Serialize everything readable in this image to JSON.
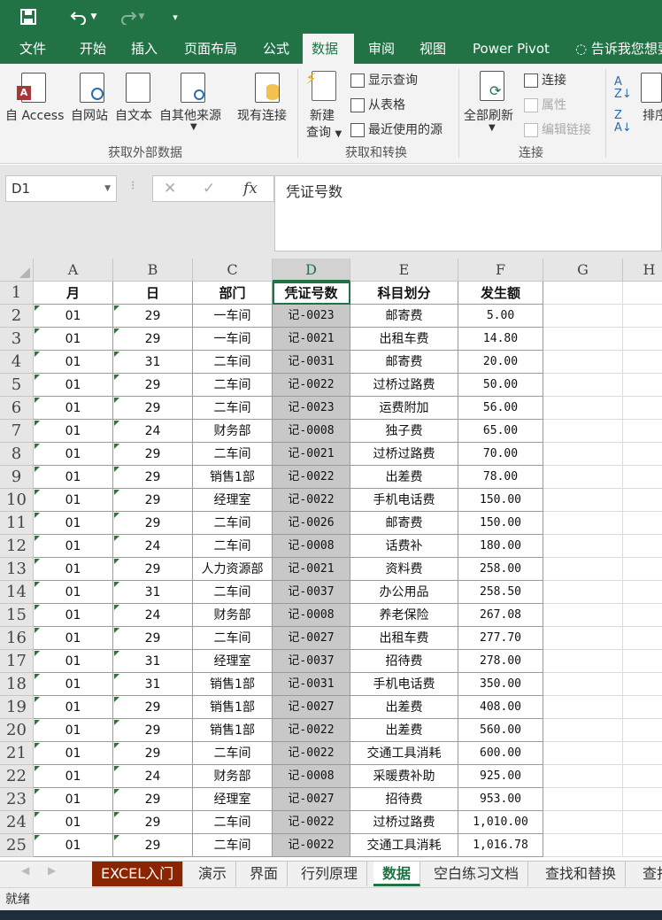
{
  "ribbon_tabs": [
    "文件",
    "开始",
    "插入",
    "页面布局",
    "公式",
    "数据",
    "审阅",
    "视图",
    "Power Pivot",
    "告诉我您想要"
  ],
  "active_tab": "数据",
  "ribbon": {
    "access": "自 Access",
    "web": "自网站",
    "text": "自文本",
    "other": "自其他来源",
    "existing": "现有连接",
    "group1": "获取外部数据",
    "new_query_1": "新建",
    "new_query_2": "查询",
    "show_query": "显示查询",
    "from_table": "从表格",
    "recent_sources": "最近使用的源",
    "group2": "获取和转换",
    "refresh_all": "全部刷新",
    "connections": "连接",
    "properties": "属性",
    "edit_links": "编辑链接",
    "group3": "连接",
    "sort": "排序"
  },
  "formula_bar": {
    "name_box": "D1",
    "fx": "fx",
    "content": "凭证号数"
  },
  "columns": [
    "A",
    "B",
    "C",
    "D",
    "E",
    "F",
    "G",
    "H"
  ],
  "selected_column": "D",
  "header_row": [
    "月",
    "日",
    "部门",
    "凭证号数",
    "科目划分",
    "发生额"
  ],
  "rows": [
    [
      "01",
      "29",
      "一车间",
      "记-0023",
      "邮寄费",
      "5.00"
    ],
    [
      "01",
      "29",
      "一车间",
      "记-0021",
      "出租车费",
      "14.80"
    ],
    [
      "01",
      "31",
      "二车间",
      "记-0031",
      "邮寄费",
      "20.00"
    ],
    [
      "01",
      "29",
      "二车间",
      "记-0022",
      "过桥过路费",
      "50.00"
    ],
    [
      "01",
      "29",
      "二车间",
      "记-0023",
      "运费附加",
      "56.00"
    ],
    [
      "01",
      "24",
      "财务部",
      "记-0008",
      "独子费",
      "65.00"
    ],
    [
      "01",
      "29",
      "二车间",
      "记-0021",
      "过桥过路费",
      "70.00"
    ],
    [
      "01",
      "29",
      "销售1部",
      "记-0022",
      "出差费",
      "78.00"
    ],
    [
      "01",
      "29",
      "经理室",
      "记-0022",
      "手机电话费",
      "150.00"
    ],
    [
      "01",
      "29",
      "二车间",
      "记-0026",
      "邮寄费",
      "150.00"
    ],
    [
      "01",
      "24",
      "二车间",
      "记-0008",
      "话费补",
      "180.00"
    ],
    [
      "01",
      "29",
      "人力资源部",
      "记-0021",
      "资料费",
      "258.00"
    ],
    [
      "01",
      "31",
      "二车间",
      "记-0037",
      "办公用品",
      "258.50"
    ],
    [
      "01",
      "24",
      "财务部",
      "记-0008",
      "养老保险",
      "267.08"
    ],
    [
      "01",
      "29",
      "二车间",
      "记-0027",
      "出租车费",
      "277.70"
    ],
    [
      "01",
      "31",
      "经理室",
      "记-0037",
      "招待费",
      "278.00"
    ],
    [
      "01",
      "31",
      "销售1部",
      "记-0031",
      "手机电话费",
      "350.00"
    ],
    [
      "01",
      "29",
      "销售1部",
      "记-0027",
      "出差费",
      "408.00"
    ],
    [
      "01",
      "29",
      "销售1部",
      "记-0022",
      "出差费",
      "560.00"
    ],
    [
      "01",
      "29",
      "二车间",
      "记-0022",
      "交通工具消耗",
      "600.00"
    ],
    [
      "01",
      "24",
      "财务部",
      "记-0008",
      "采暖费补助",
      "925.00"
    ],
    [
      "01",
      "29",
      "经理室",
      "记-0027",
      "招待费",
      "953.00"
    ],
    [
      "01",
      "29",
      "二车间",
      "记-0022",
      "过桥过路费",
      "1,010.00"
    ],
    [
      "01",
      "29",
      "二车间",
      "记-0022",
      "交通工具消耗",
      "1,016.78"
    ]
  ],
  "sheet_tabs": [
    "EXCEL入门",
    "演示",
    "界面",
    "行列原理",
    "数据",
    "空白练习文档",
    "查找和替换",
    "查找"
  ],
  "active_sheet": "数据",
  "status": "就绪",
  "colors": {
    "excel_green": "#217346",
    "selected_col": "#c8c8c8",
    "first_tab": "#8b2500"
  }
}
